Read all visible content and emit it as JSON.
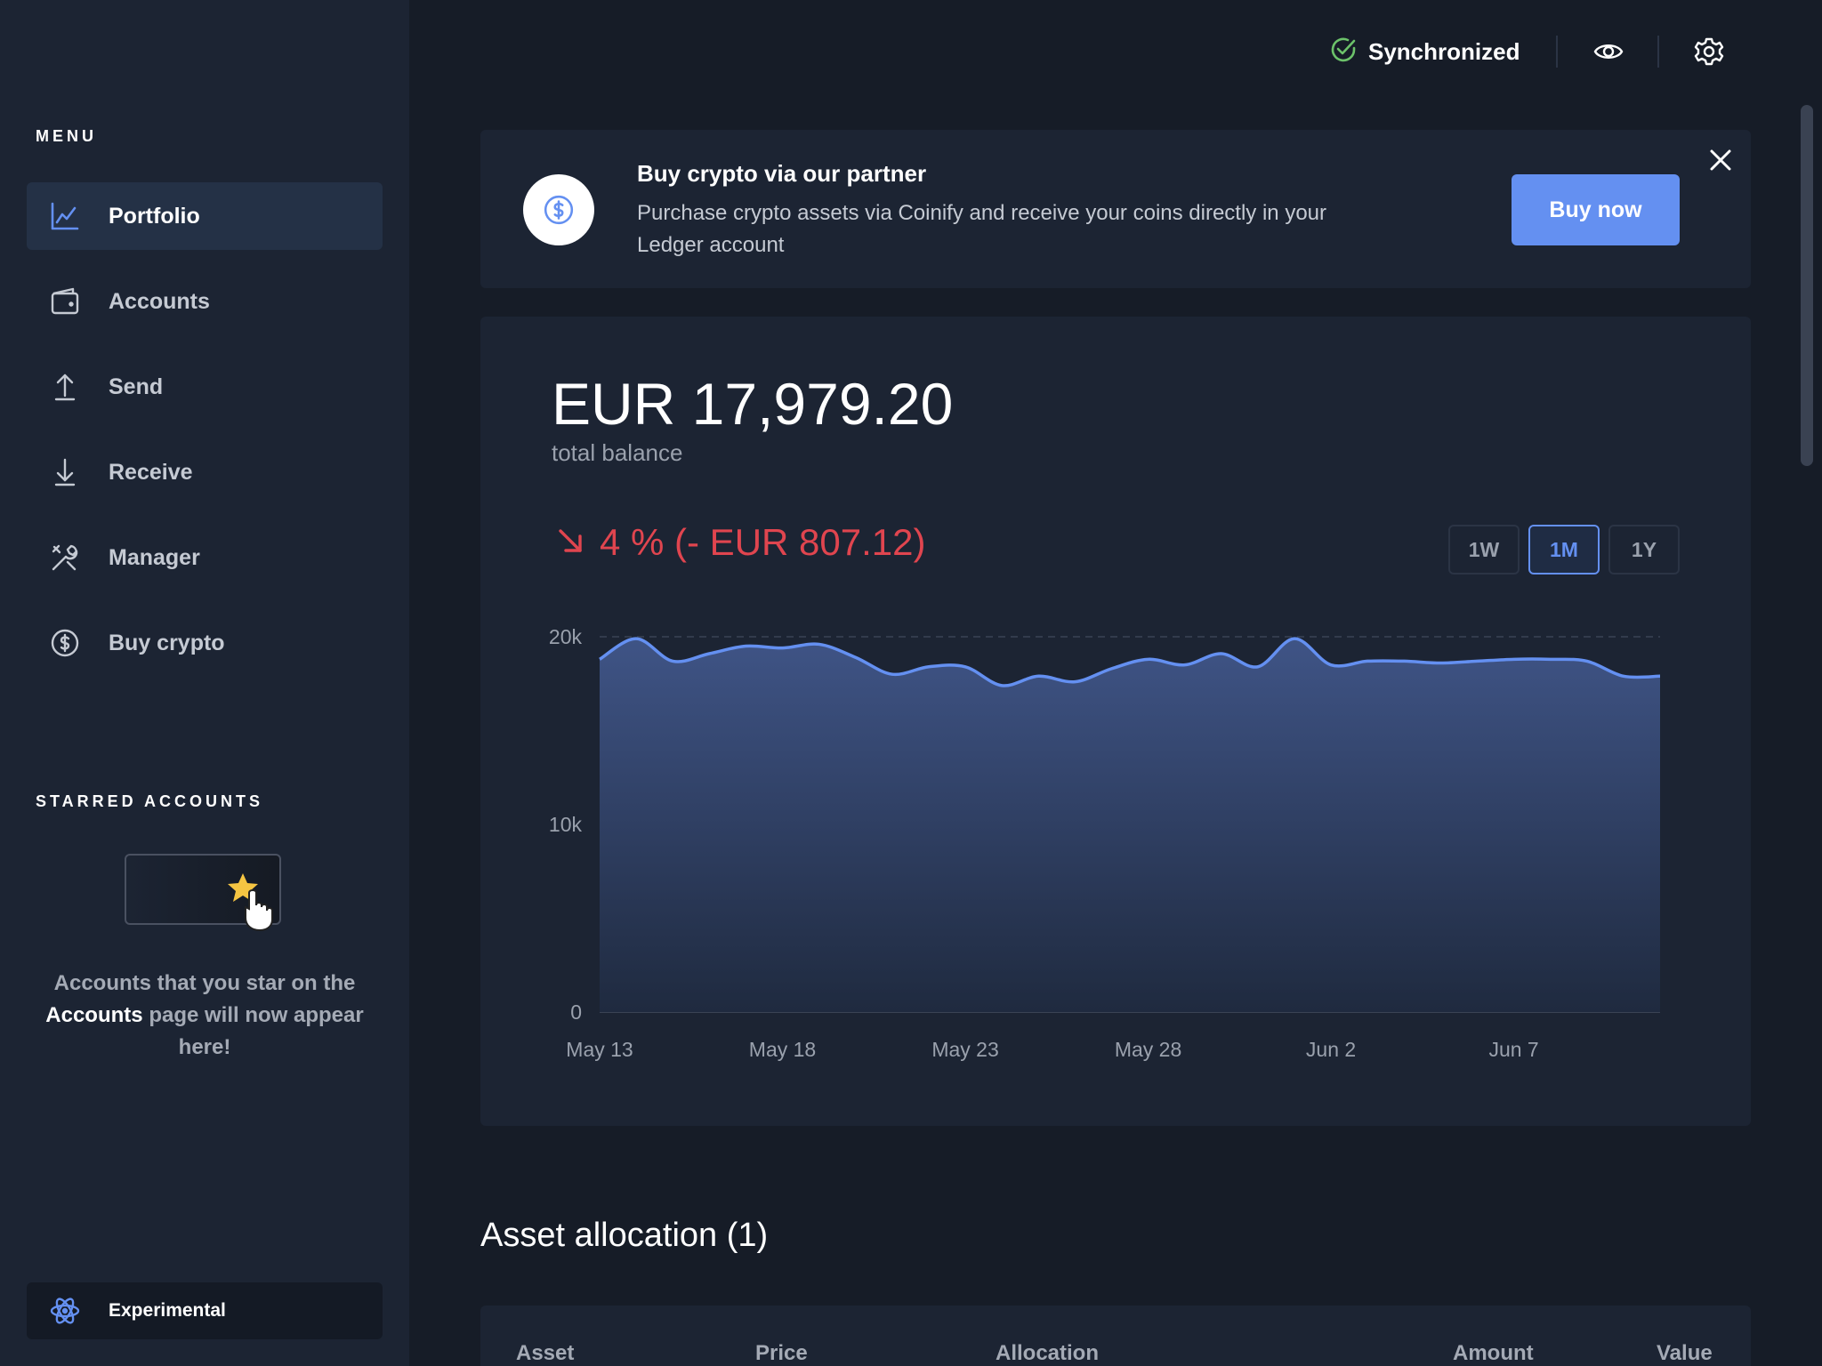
{
  "sidebar": {
    "menu_title": "MENU",
    "items": [
      {
        "label": "Portfolio",
        "icon": "chart-icon"
      },
      {
        "label": "Accounts",
        "icon": "wallet-icon"
      },
      {
        "label": "Send",
        "icon": "send-icon"
      },
      {
        "label": "Receive",
        "icon": "receive-icon"
      },
      {
        "label": "Manager",
        "icon": "tools-icon"
      },
      {
        "label": "Buy crypto",
        "icon": "dollar-icon"
      }
    ],
    "starred_title": "STARRED ACCOUNTS",
    "starred_text_1": "Accounts that you star on the",
    "starred_text_hl": "Accounts",
    "starred_text_2": "page will now appear here!",
    "experimental_label": "Experimental"
  },
  "topbar": {
    "sync_label": "Synchronized"
  },
  "banner": {
    "title": "Buy crypto via our partner",
    "description": "Purchase crypto assets via Coinify and receive your coins directly in your Ledger account",
    "button_label": "Buy now"
  },
  "balance": {
    "amount": "EUR 17,979.20",
    "label": "total balance",
    "change": "4 % (- EUR 807.12)",
    "ranges": [
      "1W",
      "1M",
      "1Y"
    ],
    "active_range": "1M"
  },
  "colors": {
    "accent": "#6490f1",
    "negative": "#e0454f",
    "success": "#6cc26a"
  },
  "chart_data": {
    "type": "area",
    "y_ticks": [
      "0",
      "10k",
      "20k"
    ],
    "ylim": [
      0,
      20000
    ],
    "x_tick_labels": [
      "May 13",
      "May 18",
      "May 23",
      "May 28",
      "Jun 2",
      "Jun 7"
    ],
    "series": [
      {
        "values": [
          18800,
          19900,
          18700,
          19100,
          19500,
          19400,
          19600,
          18900,
          18000,
          18400,
          18400,
          17400,
          17900,
          17600,
          18300,
          18800,
          18500,
          19100,
          18400,
          19900,
          18500,
          18700,
          18700,
          18600,
          18700,
          18800,
          18800,
          18700,
          17900,
          17900
        ]
      }
    ]
  },
  "allocation": {
    "title": "Asset allocation (1)",
    "columns": [
      "Asset",
      "Price",
      "Allocation",
      "Amount",
      "Value"
    ]
  }
}
